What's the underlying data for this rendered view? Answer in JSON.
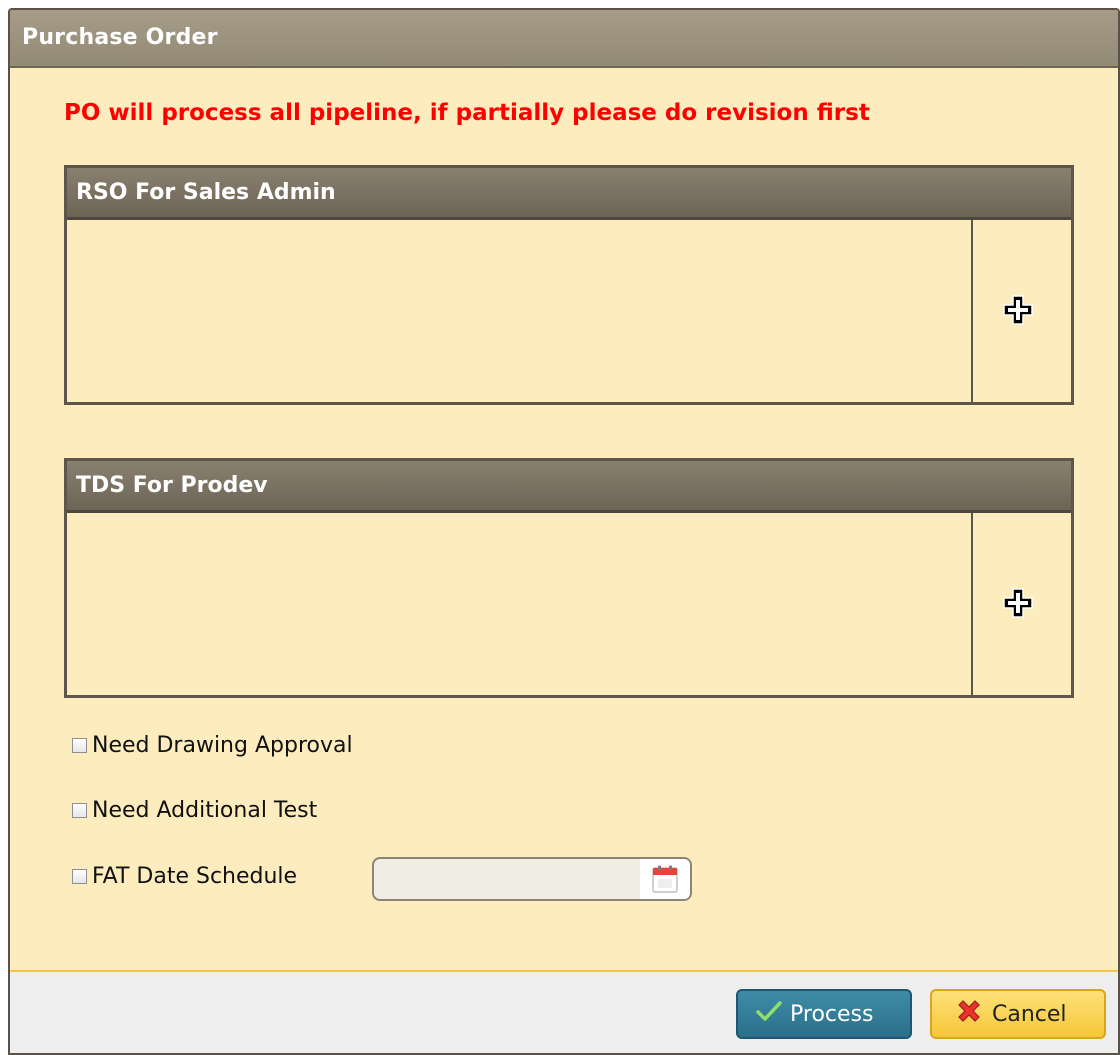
{
  "dialog": {
    "title": "Purchase Order",
    "warning": "PO will process all pipeline, if partially please do revision first"
  },
  "panels": {
    "rso": {
      "title": "RSO For Sales Admin",
      "add_icon": "plus-circle-icon"
    },
    "tds": {
      "title": "TDS For Prodev",
      "add_icon": "plus-circle-icon"
    }
  },
  "options": {
    "drawing_approval": {
      "label": "Need Drawing Approval",
      "checked": false
    },
    "additional_test": {
      "label": "Need Additional Test",
      "checked": false
    },
    "fat_date": {
      "label": "FAT Date Schedule",
      "checked": false,
      "value": "",
      "calendar_icon": "calendar-icon"
    }
  },
  "footer": {
    "process_label": "Process",
    "cancel_label": "Cancel",
    "process_icon": "checkmark-icon",
    "cancel_icon": "x-icon"
  },
  "colors": {
    "body": "#fdecbd",
    "warning": "#ff0000",
    "process_btn": "#2b6f8a",
    "cancel_btn": "#f5c637"
  }
}
